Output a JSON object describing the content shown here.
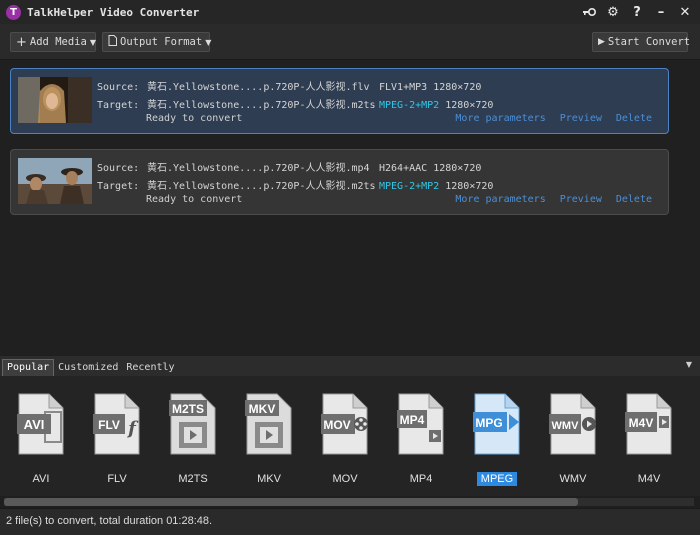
{
  "window": {
    "title": "TalkHelper Video Converter",
    "logo_letter": "T"
  },
  "toolbar": {
    "add_media": "Add Media",
    "output_format": "Output Format",
    "start_convert": "Start Convert"
  },
  "files": [
    {
      "source_label": "Source:",
      "source_name": "黄石.Yellowstone....p.720P-人人影视.flv",
      "source_codec": "FLV1+MP3",
      "source_res": "1280×720",
      "target_label": "Target:",
      "target_name": "黄石.Yellowstone....p.720P-人人影视.m2ts",
      "target_codec": "MPEG-2+MP2",
      "target_res": "1280×720",
      "status": "Ready to convert",
      "more": "More parameters",
      "preview": "Preview",
      "delete": "Delete"
    },
    {
      "source_label": "Source:",
      "source_name": "黄石.Yellowstone....p.720P-人人影视.mp4",
      "source_codec": "H264+AAC",
      "source_res": "1280×720",
      "target_label": "Target:",
      "target_name": "黄石.Yellowstone....p.720P-人人影视.m2ts",
      "target_codec": "MPEG-2+MP2",
      "target_res": "1280×720",
      "status": "Ready to convert",
      "more": "More parameters",
      "preview": "Preview",
      "delete": "Delete"
    }
  ],
  "tabs": [
    "Popular",
    "Customized",
    "Recently"
  ],
  "formats": [
    {
      "icon": "AVI",
      "label": "AVI"
    },
    {
      "icon": "FLV",
      "label": "FLV"
    },
    {
      "icon": "M2TS",
      "label": "M2TS"
    },
    {
      "icon": "MKV",
      "label": "MKV"
    },
    {
      "icon": "MOV",
      "label": "MOV"
    },
    {
      "icon": "MP4",
      "label": "MP4"
    },
    {
      "icon": "MPG",
      "label": "MPEG"
    },
    {
      "icon": "WMV",
      "label": "WMV"
    },
    {
      "icon": "M4V",
      "label": "M4V"
    }
  ],
  "selected_format": "MPEG",
  "status_text": "2 file(s) to convert, total duration 01:28:48.",
  "colors": {
    "accent": "#2e8ae0",
    "link": "#4b8fd6",
    "target_codec": "#2ec8e6"
  }
}
